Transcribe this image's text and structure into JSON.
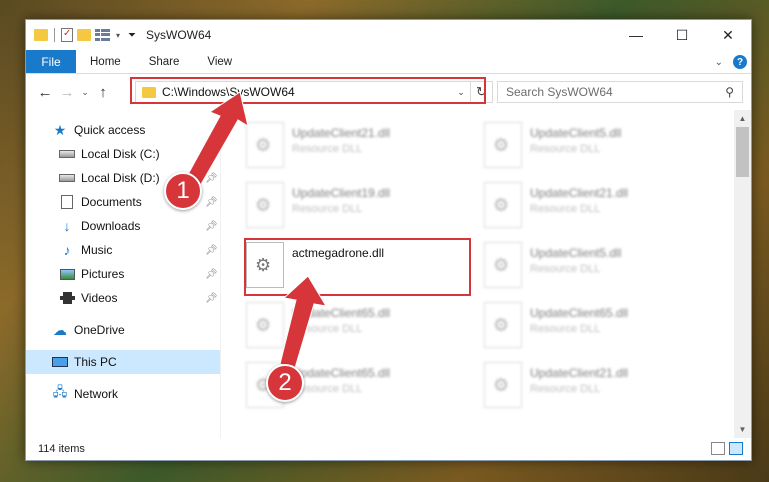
{
  "window": {
    "title": "SysWOW64",
    "controls": {
      "minimize": "—",
      "maximize": "☐",
      "close": "✕"
    }
  },
  "ribbon": {
    "tabs": [
      "File",
      "Home",
      "Share",
      "View"
    ],
    "help": "?"
  },
  "nav": {
    "address": "C:\\Windows\\SysWOW64",
    "search_placeholder": "Search SysWOW64"
  },
  "sidebar": {
    "items": [
      {
        "label": "Quick access",
        "icon": "star-icon",
        "pinned": false
      },
      {
        "label": "Local Disk (C:)",
        "icon": "disk-icon",
        "pinned": true
      },
      {
        "label": "Local Disk (D:)",
        "icon": "disk-icon",
        "pinned": true
      },
      {
        "label": "Documents",
        "icon": "documents-icon",
        "pinned": true
      },
      {
        "label": "Downloads",
        "icon": "download-icon",
        "pinned": true
      },
      {
        "label": "Music",
        "icon": "music-icon",
        "pinned": true
      },
      {
        "label": "Pictures",
        "icon": "pictures-icon",
        "pinned": true
      },
      {
        "label": "Videos",
        "icon": "videos-icon",
        "pinned": true
      },
      {
        "label": "OneDrive",
        "icon": "cloud-icon",
        "pinned": false
      },
      {
        "label": "This PC",
        "icon": "computer-icon",
        "pinned": false,
        "selected": true
      },
      {
        "label": "Network",
        "icon": "network-icon",
        "pinned": false
      }
    ]
  },
  "files": [
    {
      "name": "UpdateClient21.dll",
      "type": "Resource DLL"
    },
    {
      "name": "UpdateClient5.dll",
      "type": "Resource DLL"
    },
    {
      "name": "UpdateClient19.dll",
      "type": "Resource DLL"
    },
    {
      "name": "UpdateClient21.dll",
      "type": "Resource DLL"
    },
    {
      "name": "actmegadrone.dll",
      "type": ""
    },
    {
      "name": "UpdateClient5.dll",
      "type": "Resource DLL"
    },
    {
      "name": "UpdateClient65.dll",
      "type": "Resource DLL"
    },
    {
      "name": "UpdateClient65.dll",
      "type": "Resource DLL"
    },
    {
      "name": "UpdateClient65.dll",
      "type": "Resource DLL"
    },
    {
      "name": "UpdateClient21.dll",
      "type": "Resource DLL"
    }
  ],
  "status": {
    "item_count": "114 items"
  },
  "callouts": {
    "one": "1",
    "two": "2"
  },
  "colors": {
    "accent": "#1979ca",
    "highlight": "#d6353a",
    "selected_bg": "#cce8ff"
  }
}
